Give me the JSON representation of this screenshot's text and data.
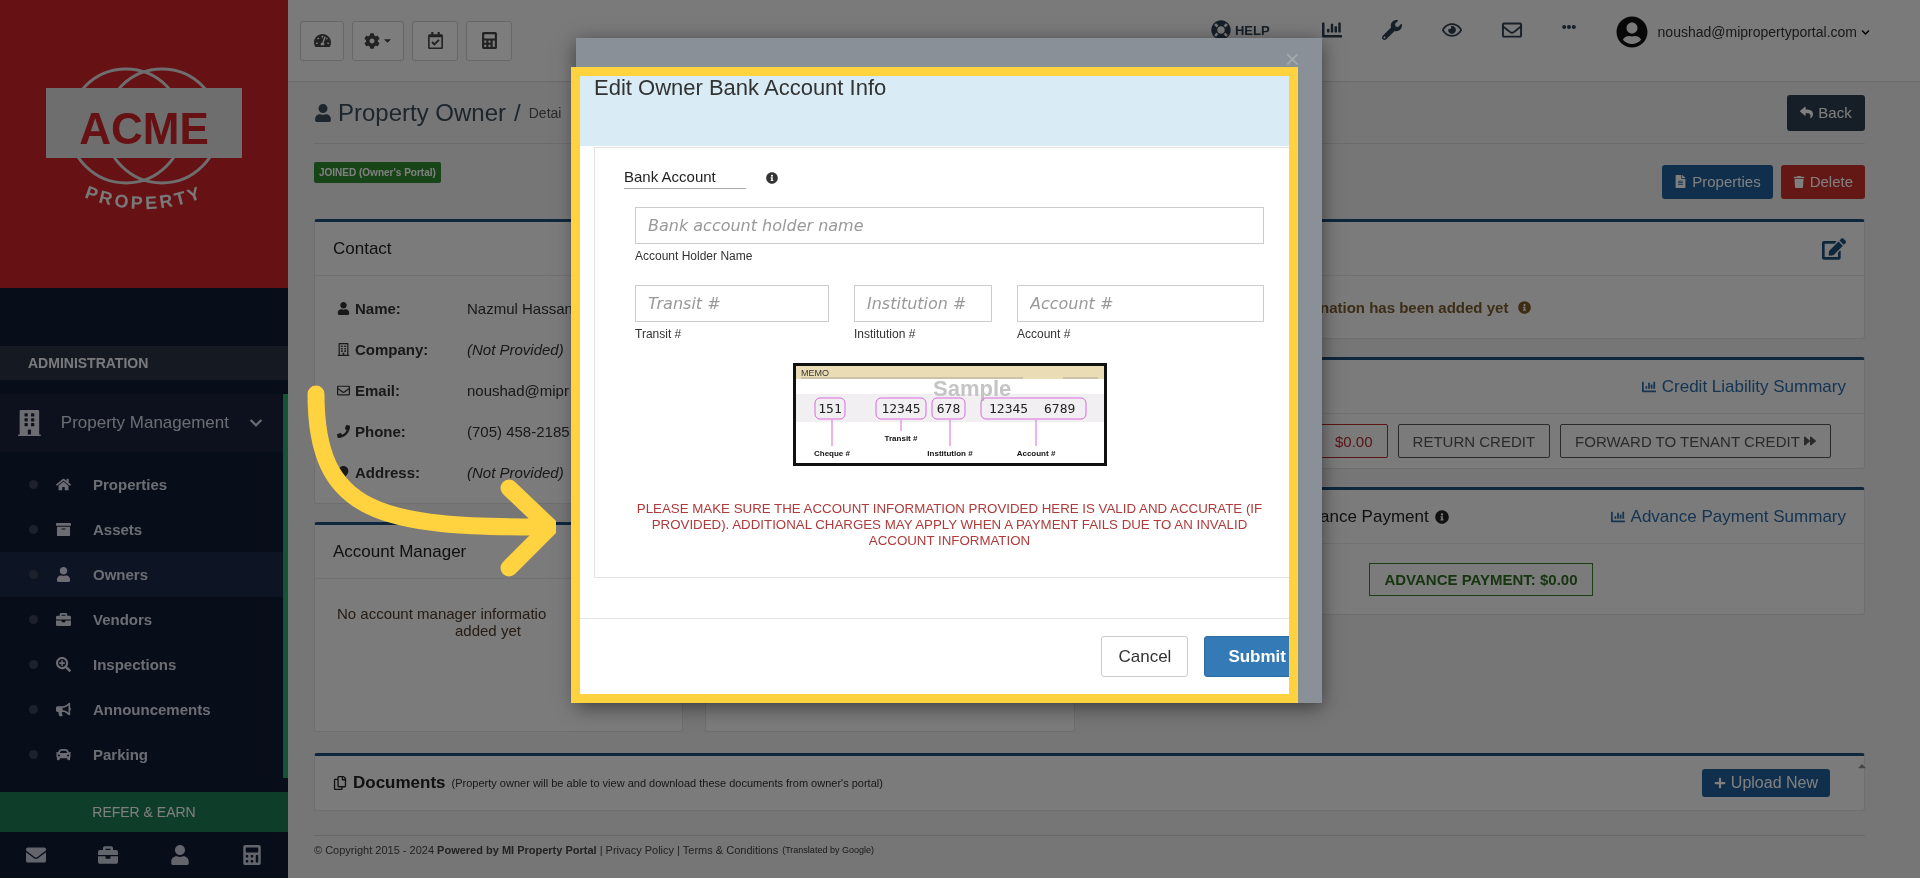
{
  "sidebar": {
    "logo": {
      "word": "ACME",
      "sub": "PROPERTY"
    },
    "section": "ADMINISTRATION",
    "group": {
      "label": "Property Management",
      "expanded": true,
      "items": [
        {
          "label": "Properties",
          "selected": false
        },
        {
          "label": "Assets",
          "selected": false
        },
        {
          "label": "Owners",
          "selected": true
        },
        {
          "label": "Vendors",
          "selected": false
        },
        {
          "label": "Inspections",
          "selected": false
        },
        {
          "label": "Announcements",
          "selected": false
        },
        {
          "label": "Parking",
          "selected": false
        }
      ]
    },
    "refer": "REFER & EARN"
  },
  "topbar": {
    "help": "HELP",
    "user": "noushad@mipropertyportal.com"
  },
  "header": {
    "title": "Property Owner",
    "separator": "/",
    "crumb": "Detai",
    "back": "Back",
    "badge": "JOINED (Owner's Portal)",
    "actions": [
      "Properties",
      "Delete"
    ]
  },
  "contact": {
    "title": "Contact",
    "rows": [
      {
        "label": "Name:",
        "value": "Nazmul Hassan",
        "kind": "value"
      },
      {
        "label": "Company:",
        "value": "(Not Provided)",
        "kind": "missing"
      },
      {
        "label": "Email:",
        "value": "noushad@mipr",
        "kind": "value"
      },
      {
        "label": "Phone:",
        "value": "(705) 458-2185",
        "kind": "value"
      },
      {
        "label": "Address:",
        "value": "(Not Provided)",
        "kind": "missing"
      }
    ]
  },
  "account_manager": {
    "title": "Account Manager",
    "lines": [
      "No account manager informatio",
      "added yet"
    ]
  },
  "bank_card": {
    "message": "nation has been added yet"
  },
  "credit": {
    "link": "Credit Liability Summary",
    "balance": "$0.00",
    "buttons": [
      "RETURN CREDIT",
      "FORWARD TO TENANT CREDIT"
    ]
  },
  "advance": {
    "title": "ance Payment",
    "link": "Advance Payment Summary",
    "amount": "ADVANCE PAYMENT: $0.00"
  },
  "documents": {
    "title": "Documents",
    "note": "(Property owner will be able to view and download these documents from owner's portal)",
    "upload": "Upload New"
  },
  "footer": {
    "text": "© Copyright 2015 - 2024 **Powered by MI Property Portal** | Privacy Policy | Terms & Conditions",
    "translate": "(Translated by Google)"
  },
  "modal": {
    "close": "×",
    "title": "Edit Owner Bank Account Info",
    "section": "Bank Account",
    "holder": {
      "placeholder": "Bank account holder name",
      "label": "Account Holder Name"
    },
    "fields": [
      {
        "placeholder": "Transit #",
        "label": "Transit #"
      },
      {
        "placeholder": "Institution #",
        "label": "Institution #"
      },
      {
        "placeholder": "Account #",
        "label": "Account #"
      }
    ],
    "cheque": {
      "memo": "MEMO",
      "watermark": "Sample",
      "micr": [
        "151",
        "12345",
        "678",
        "12345",
        "6789"
      ],
      "labels": [
        "Cheque #",
        "Transit #",
        "Institution #",
        "Account #"
      ]
    },
    "warning": "PLEASE MAKE SURE THE ACCOUNT INFORMATION PROVIDED HERE IS VALID AND ACCURATE (IF PROVIDED). ADDITIONAL CHARGES MAY APPLY WHEN A PAYMENT FAILS DUE TO AN INVALID ACCOUNT INFORMATION",
    "cancel": "Cancel",
    "submit": "Submit"
  }
}
